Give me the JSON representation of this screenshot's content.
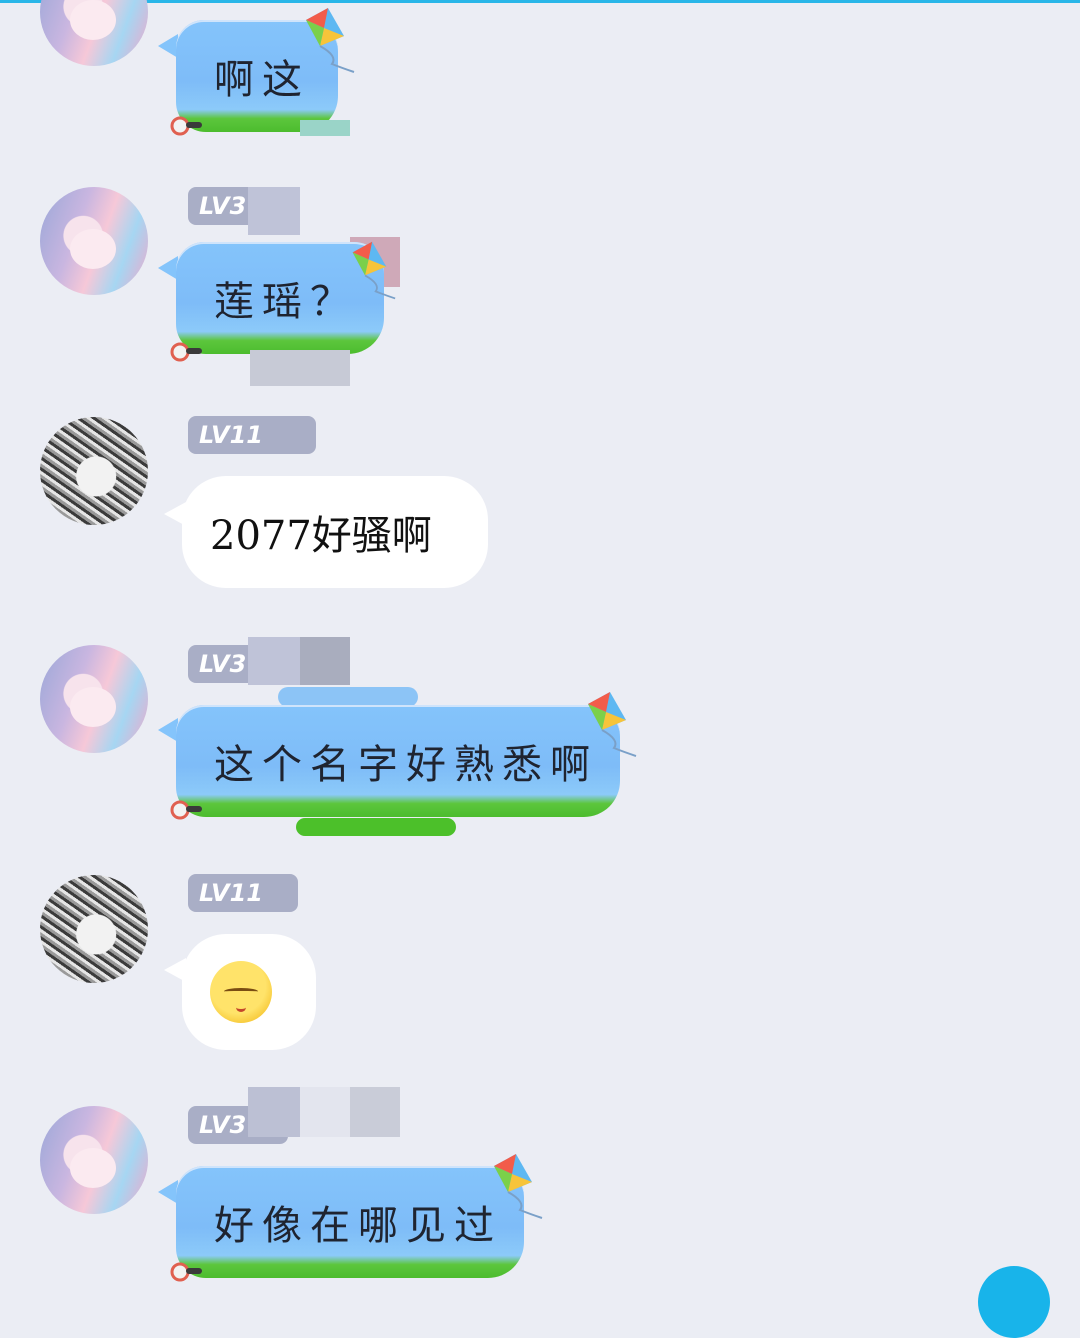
{
  "messages": [
    {
      "sender": "user-a",
      "level": "",
      "text": "啊这",
      "style": "blue-kite-bubble"
    },
    {
      "sender": "user-a",
      "level": "LV3",
      "text": "莲瑶？",
      "style": "blue-kite-bubble"
    },
    {
      "sender": "user-b",
      "level": "LV11",
      "text": "2077好骚啊",
      "style": "white-bubble"
    },
    {
      "sender": "user-a",
      "level": "LV3",
      "text": "这个名字好熟悉啊",
      "style": "blue-kite-bubble"
    },
    {
      "sender": "user-b",
      "level": "LV11",
      "text": "",
      "emoji": "pensive-face-icon",
      "style": "white-bubble"
    },
    {
      "sender": "user-a",
      "level": "LV3",
      "text": "好像在哪见过",
      "style": "blue-kite-bubble"
    }
  ],
  "colors": {
    "background": "#ebedf4",
    "level_tag": "#a9aec6",
    "bubble_blue": "#84c4fb",
    "bubble_grass": "#4cbc2e",
    "fab": "#18b4ea"
  }
}
